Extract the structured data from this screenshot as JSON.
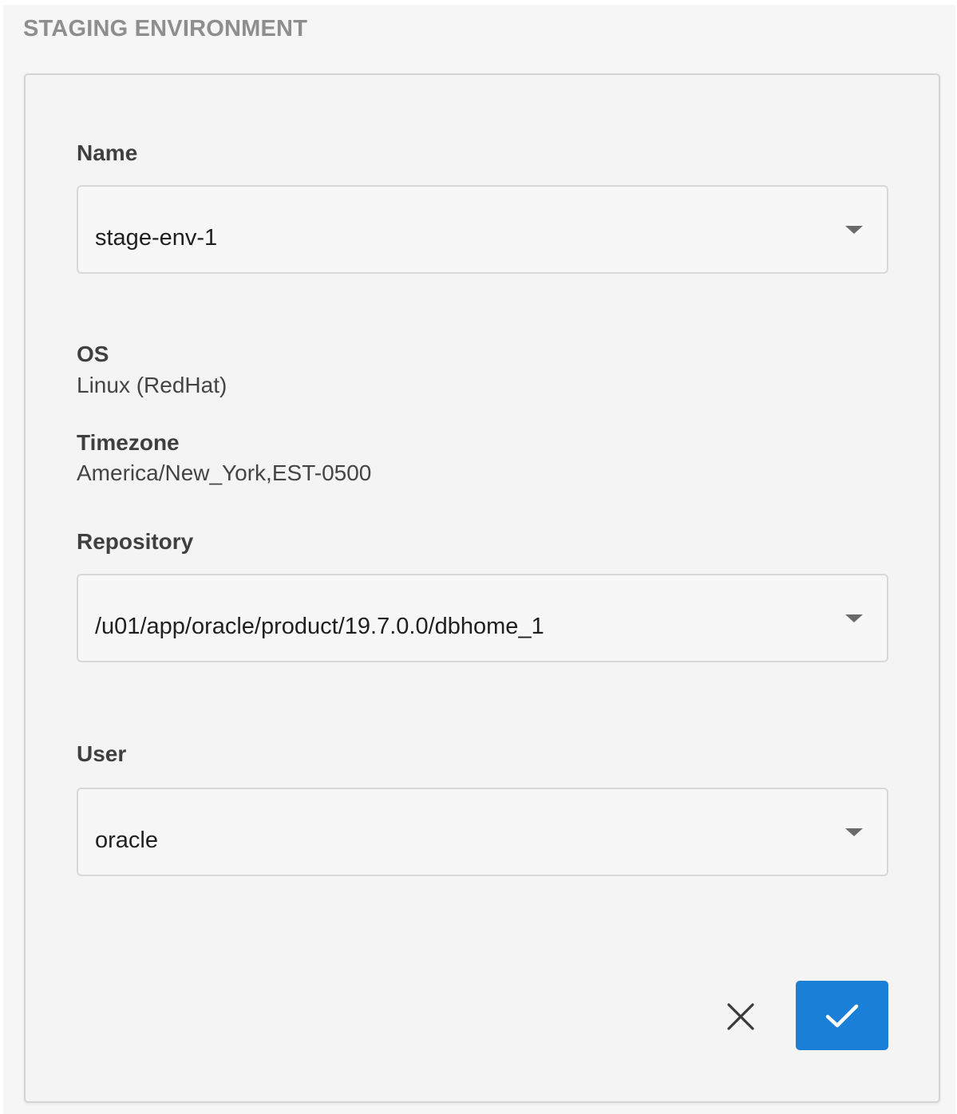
{
  "section": {
    "title": "STAGING ENVIRONMENT"
  },
  "form": {
    "name": {
      "label": "Name",
      "value": "stage-env-1"
    },
    "os": {
      "label": "OS",
      "value": "Linux (RedHat)"
    },
    "timezone": {
      "label": "Timezone",
      "value": "America/New_York,EST-0500"
    },
    "repository": {
      "label": "Repository",
      "value": "/u01/app/oracle/product/19.7.0.0/dbhome_1"
    },
    "user": {
      "label": "User",
      "value": "oracle"
    }
  },
  "actions": {
    "cancel_icon": "close-icon",
    "confirm_icon": "checkmark-icon",
    "confirm_color": "#1a7fd6"
  }
}
